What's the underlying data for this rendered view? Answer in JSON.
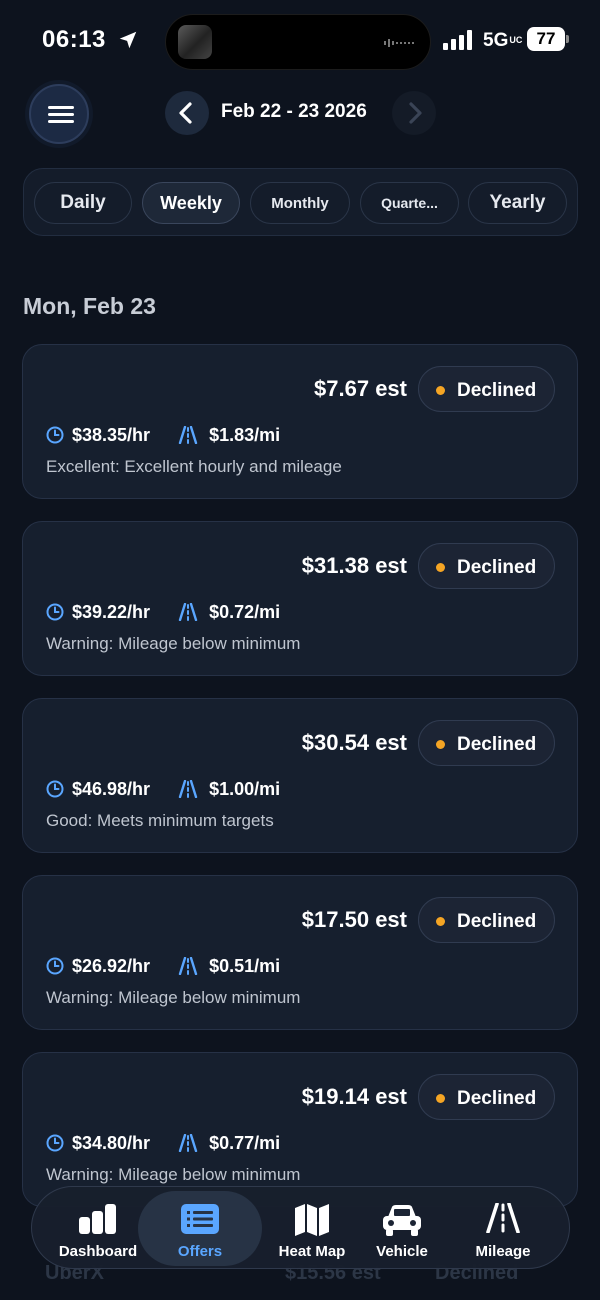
{
  "status_bar": {
    "time": "06:13",
    "network": "5G",
    "network_suffix": "UC",
    "battery": "77"
  },
  "header": {
    "date_range": "Feb 22 - 23 2026"
  },
  "period_tabs": [
    {
      "label": "Daily",
      "active": false
    },
    {
      "label": "Weekly",
      "active": true
    },
    {
      "label": "Monthly",
      "active": false
    },
    {
      "label": "Quarte...",
      "active": false
    },
    {
      "label": "Yearly",
      "active": false
    }
  ],
  "day_heading": "Mon, Feb 23",
  "offers": [
    {
      "est": "$7.67 est",
      "status": "Declined",
      "hourly": "$38.35/hr",
      "per_mile": "$1.83/mi",
      "note": "Excellent: Excellent hourly and mileage"
    },
    {
      "est": "$31.38 est",
      "status": "Declined",
      "hourly": "$39.22/hr",
      "per_mile": "$0.72/mi",
      "note": "Warning: Mileage below minimum"
    },
    {
      "est": "$30.54 est",
      "status": "Declined",
      "hourly": "$46.98/hr",
      "per_mile": "$1.00/mi",
      "note": "Good: Meets minimum targets"
    },
    {
      "est": "$17.50 est",
      "status": "Declined",
      "hourly": "$26.92/hr",
      "per_mile": "$0.51/mi",
      "note": "Warning: Mileage below minimum"
    },
    {
      "est": "$19.14 est",
      "status": "Declined",
      "hourly": "$34.80/hr",
      "per_mile": "$0.77/mi",
      "note": "Warning: Mileage below minimum"
    }
  ],
  "partial_offer": {
    "label": "UberX",
    "est": "$15.56 est",
    "status": "Declined"
  },
  "bottom_nav": [
    {
      "label": "Dashboard",
      "icon": "bar-chart-icon",
      "active": false
    },
    {
      "label": "Offers",
      "icon": "list-icon",
      "active": true
    },
    {
      "label": "Heat Map",
      "icon": "map-icon",
      "active": false
    },
    {
      "label": "Vehicle",
      "icon": "car-icon",
      "active": false
    },
    {
      "label": "Mileage",
      "icon": "road-icon",
      "active": false
    }
  ],
  "colors": {
    "background": "#0d131e",
    "card": "#161f2e",
    "accent": "#5aa6ff",
    "status_dot": "#f5a524"
  }
}
